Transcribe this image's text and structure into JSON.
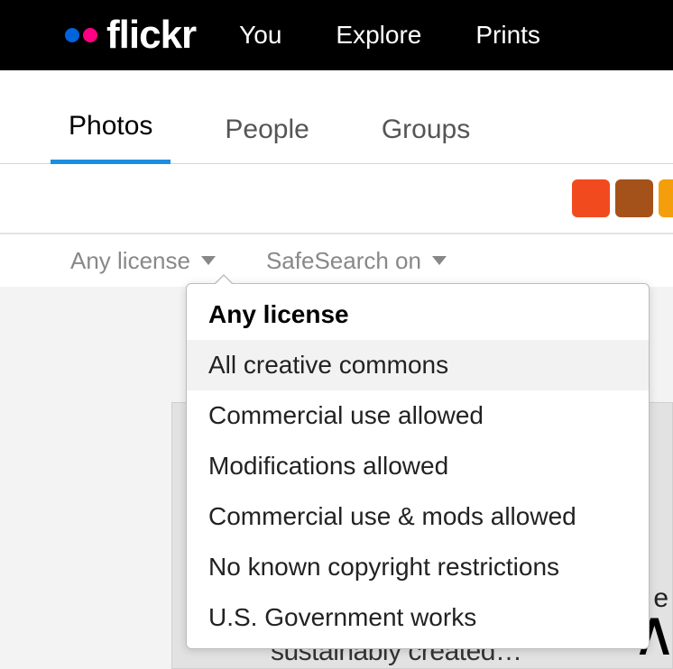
{
  "brand": {
    "name": "flickr"
  },
  "nav": {
    "you": "You",
    "explore": "Explore",
    "prints": "Prints"
  },
  "tabs": {
    "photos": "Photos",
    "people": "People",
    "groups": "Groups"
  },
  "swatches": {
    "c1": "#f24a1f",
    "c2": "#a5521a",
    "c3": "#f59e0b"
  },
  "filters": {
    "license_label": "Any license",
    "safesearch_label": "SafeSearch on"
  },
  "license_menu": {
    "items": [
      "Any license",
      "All creative commons",
      "Commercial use allowed",
      "Modifications allowed",
      "Commercial use & mods allowed",
      "No known copyright restrictions",
      "U.S. Government works"
    ],
    "selected_index": 0,
    "hover_index": 1
  },
  "bg": {
    "fragment": "e",
    "wave": "∧",
    "bottom": "sustainably created…"
  }
}
